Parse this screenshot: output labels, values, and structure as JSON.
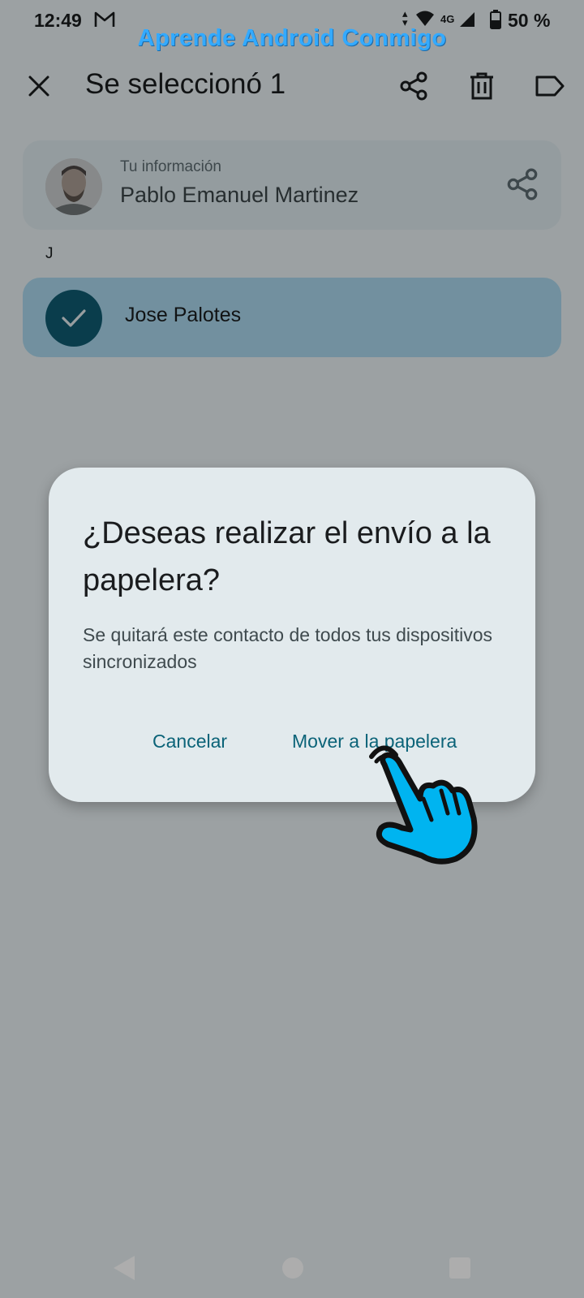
{
  "status_bar": {
    "time": "12:49",
    "network_type": "4G",
    "battery": "50 %"
  },
  "watermark": "Aprende Android Conmigo",
  "top_bar": {
    "title": "Se seleccionó 1",
    "icons": [
      "close-icon",
      "share-icon",
      "trash-icon",
      "label-icon"
    ]
  },
  "profile": {
    "label": "Tu información",
    "name": "Pablo Emanuel Martinez"
  },
  "section_letter": "J",
  "contact": {
    "name": "Jose Palotes",
    "selected": true
  },
  "dialog": {
    "title": "¿Deseas realizar el envío a la papelera?",
    "body": "Se quitará este contacto de todos tus dispositivos sincronizados",
    "cancel_label": "Cancelar",
    "confirm_label": "Mover a la papelera"
  },
  "colors": {
    "accent": "#0b6378",
    "selected_row": "#a9d5ea",
    "check_circle": "#0f5b70",
    "watermark": "#33aaff",
    "pointer_hand": "#00b4f0"
  }
}
